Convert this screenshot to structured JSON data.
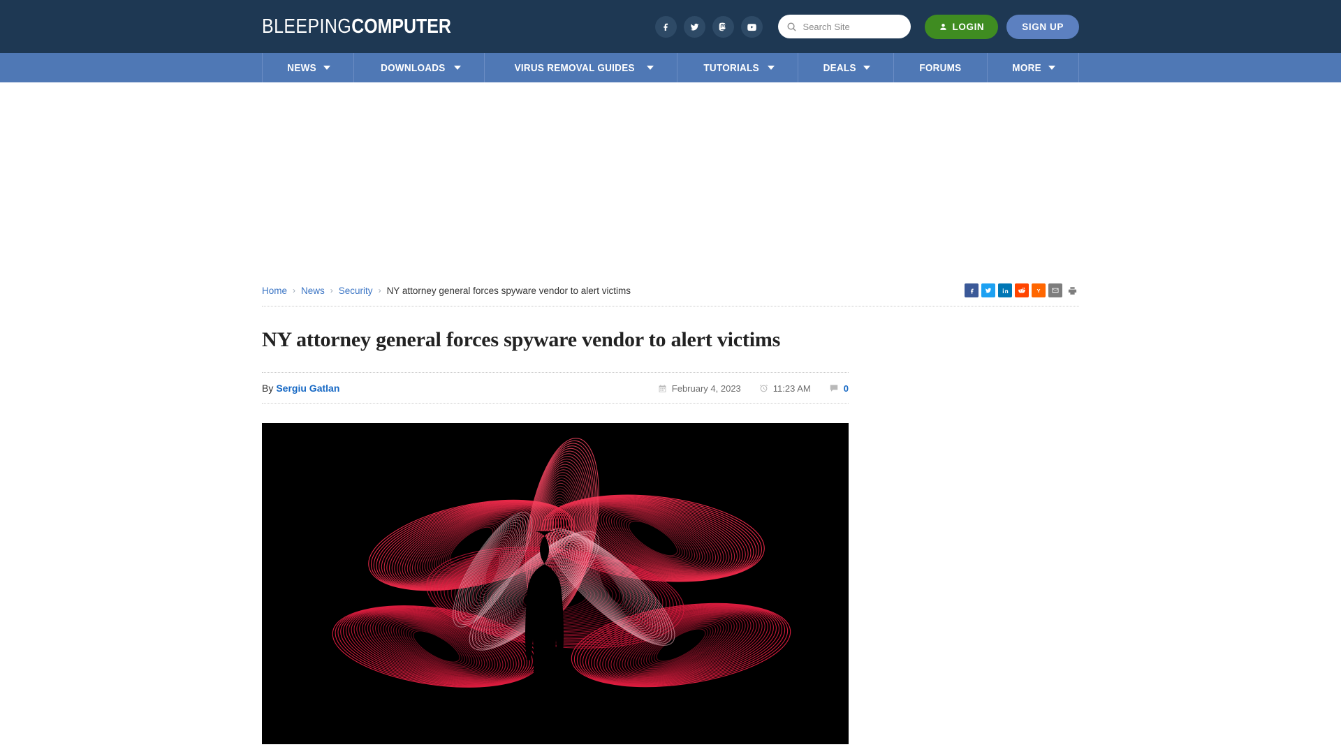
{
  "site": {
    "logo_light": "BLEEPING",
    "logo_bold": "COMPUTER"
  },
  "header": {
    "social": [
      {
        "name": "facebook-icon",
        "label": "Facebook"
      },
      {
        "name": "twitter-icon",
        "label": "Twitter"
      },
      {
        "name": "mastodon-icon",
        "label": "Mastodon"
      },
      {
        "name": "youtube-icon",
        "label": "YouTube"
      }
    ],
    "search": {
      "placeholder": "Search Site",
      "value": ""
    },
    "login_label": "LOGIN",
    "signup_label": "SIGN UP",
    "colors": {
      "header_bg": "#1e3853",
      "nav_bg": "#4f78b5",
      "login_green": "#3f8c21",
      "signup_blue": "#5c80c0"
    }
  },
  "nav": {
    "items": [
      {
        "label": "NEWS",
        "has_caret": true
      },
      {
        "label": "DOWNLOADS",
        "has_caret": true
      },
      {
        "label": "VIRUS REMOVAL GUIDES",
        "has_caret": true
      },
      {
        "label": "TUTORIALS",
        "has_caret": true
      },
      {
        "label": "DEALS",
        "has_caret": true
      },
      {
        "label": "FORUMS",
        "has_caret": false
      },
      {
        "label": "MORE",
        "has_caret": true
      }
    ]
  },
  "breadcrumb": {
    "separator": "›",
    "items": [
      {
        "label": "Home",
        "is_link": true
      },
      {
        "label": "News",
        "is_link": true
      },
      {
        "label": "Security",
        "is_link": true
      },
      {
        "label": "NY attorney general forces spyware vendor to alert victims",
        "is_link": false
      }
    ]
  },
  "share": [
    {
      "name": "share-facebook-icon",
      "label": "Facebook"
    },
    {
      "name": "share-twitter-icon",
      "label": "Twitter"
    },
    {
      "name": "share-linkedin-icon",
      "label": "LinkedIn"
    },
    {
      "name": "share-reddit-icon",
      "label": "Reddit"
    },
    {
      "name": "share-hackernews-icon",
      "label": "Y"
    },
    {
      "name": "share-email-icon",
      "label": "Email"
    },
    {
      "name": "share-print-icon",
      "label": "Print"
    }
  ],
  "article": {
    "title": "NY attorney general forces spyware vendor to alert victims",
    "by_label": "By",
    "author": "Sergiu Gatlan",
    "date": "February 4, 2023",
    "time": "11:23 AM",
    "comment_count": "0",
    "hero_alt": "Red neon light-painting spiral pattern behind a dark human silhouette"
  }
}
